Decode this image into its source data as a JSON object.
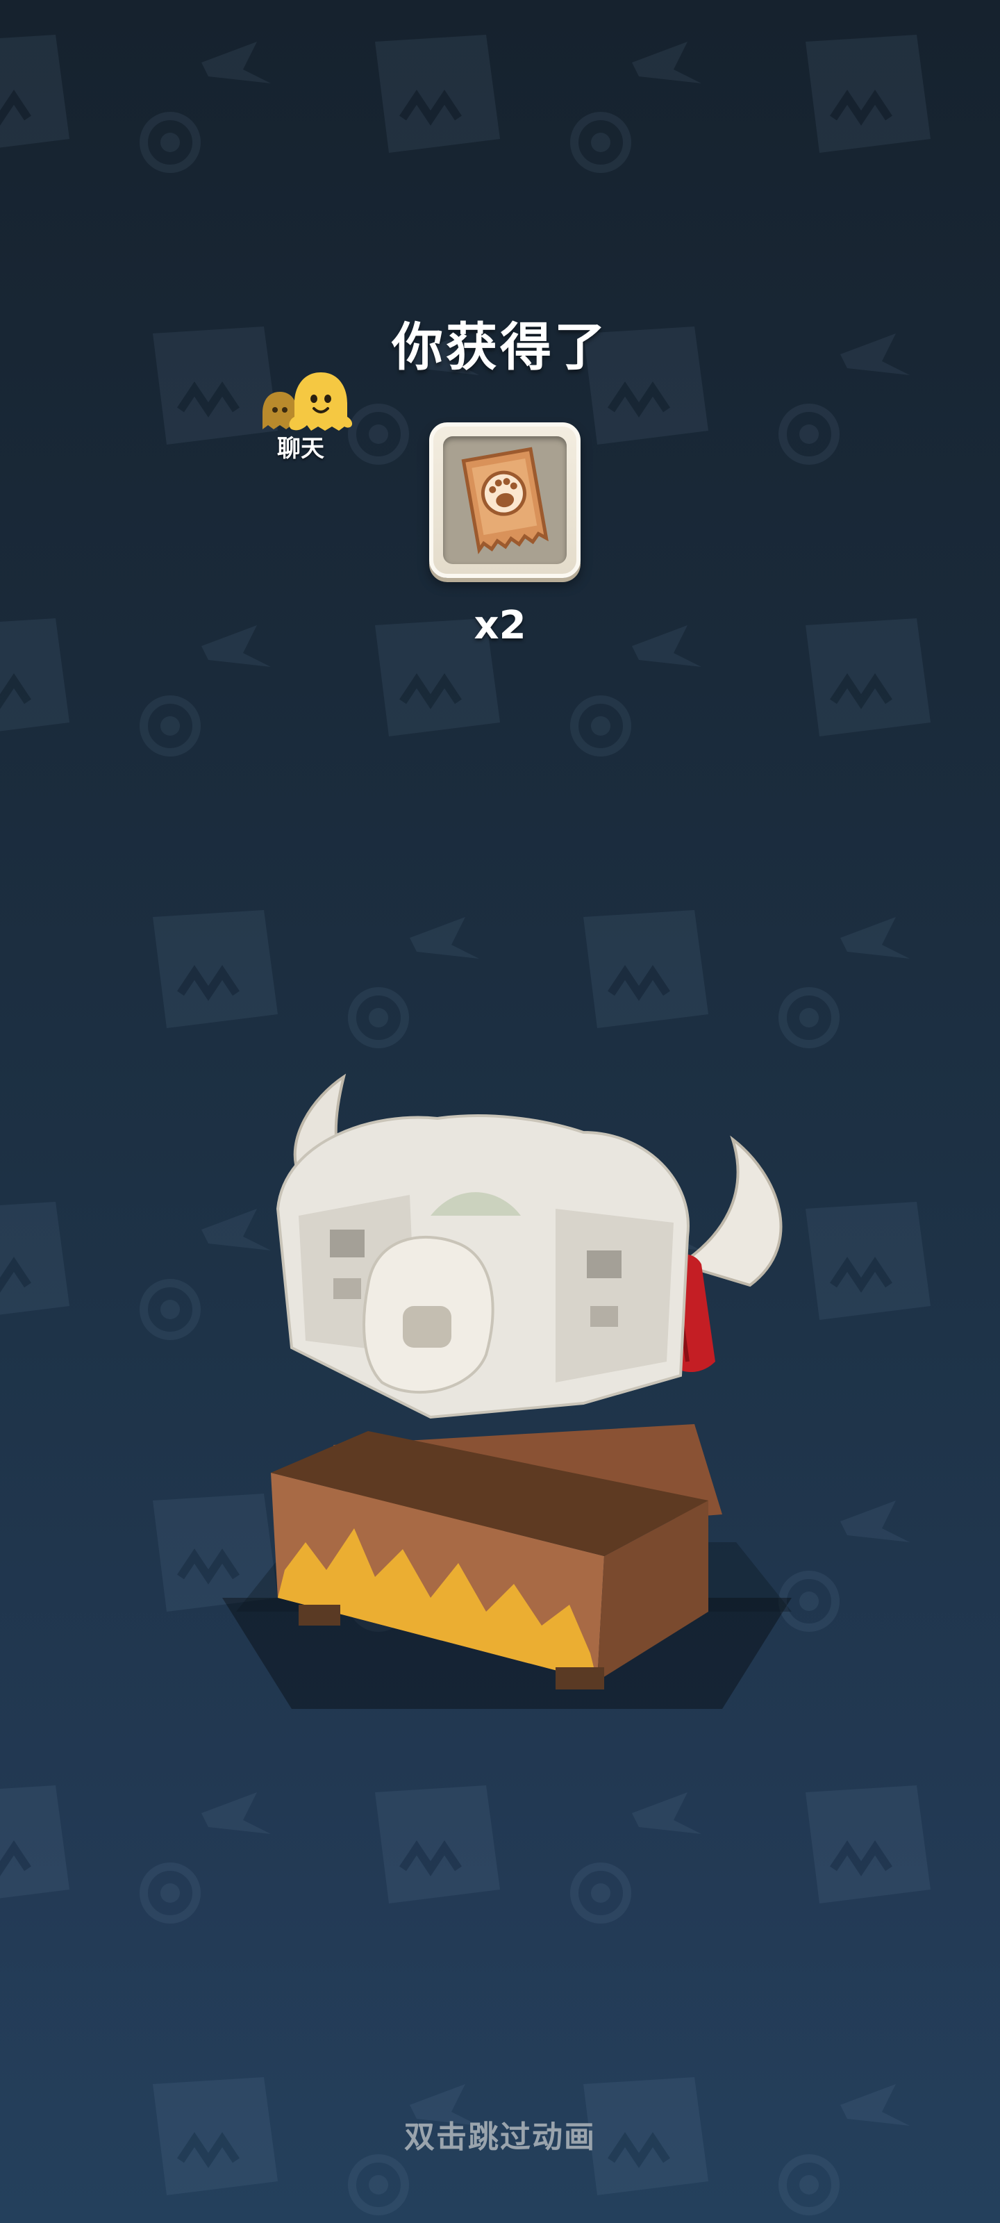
{
  "title": "你获得了",
  "chat": {
    "label": "聊天",
    "icon": "ghost-chat-icon"
  },
  "reward": {
    "icon": "paw-ticket-icon",
    "count_label": "x2",
    "count": 2
  },
  "skip_hint": "双击跳过动画",
  "colors": {
    "background_top": "#16222e",
    "background_bottom": "#24405c",
    "ghost_yellow": "#f5c842",
    "ghost_dark": "#b98a2c",
    "ticket_orange": "#d9925a",
    "chest_wood": "#a86a45",
    "horn_ribbon_red": "#c41e24"
  }
}
